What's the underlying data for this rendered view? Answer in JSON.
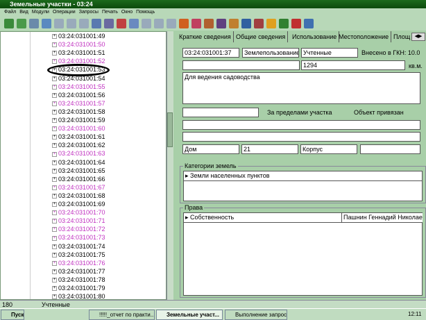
{
  "window": {
    "title": "Земельные участки - 03:24"
  },
  "menu": [
    "Файл",
    "Вид",
    "Модули",
    "Операции",
    "Запросы",
    "Печать",
    "Окно",
    "Помощь"
  ],
  "tree": {
    "items": [
      {
        "label": "03:24:031001:49",
        "color": "#000"
      },
      {
        "label": "03:24:031001:50",
        "color": "#c030c0"
      },
      {
        "label": "03:24:031001:51",
        "color": "#000"
      },
      {
        "label": "03:24:031001:52",
        "color": "#c030c0"
      },
      {
        "label": "03:24:031001:53",
        "color": "#000"
      },
      {
        "label": "03:24:031001:54",
        "color": "#000"
      },
      {
        "label": "03:24:031001:55",
        "color": "#c030c0"
      },
      {
        "label": "03:24:031001:56",
        "color": "#000"
      },
      {
        "label": "03:24:031001:57",
        "color": "#c030c0"
      },
      {
        "label": "03:24:031001:58",
        "color": "#000"
      },
      {
        "label": "03:24:031001:59",
        "color": "#000"
      },
      {
        "label": "03:24:031001:60",
        "color": "#c030c0"
      },
      {
        "label": "03:24:031001:61",
        "color": "#000"
      },
      {
        "label": "03:24:031001:62",
        "color": "#000"
      },
      {
        "label": "03:24:031001:63",
        "color": "#c030c0"
      },
      {
        "label": "03:24:031001:64",
        "color": "#000"
      },
      {
        "label": "03:24:031001:65",
        "color": "#000"
      },
      {
        "label": "03:24:031001:66",
        "color": "#000"
      },
      {
        "label": "03:24:031001:67",
        "color": "#c030c0"
      },
      {
        "label": "03:24:031001:68",
        "color": "#000"
      },
      {
        "label": "03:24:031001:69",
        "color": "#000"
      },
      {
        "label": "03:24:031001:70",
        "color": "#c030c0"
      },
      {
        "label": "03:24:031001:71",
        "color": "#c030c0"
      },
      {
        "label": "03:24:031001:72",
        "color": "#c030c0"
      },
      {
        "label": "03:24:031001:73",
        "color": "#c030c0"
      },
      {
        "label": "03:24:031001:74",
        "color": "#000"
      },
      {
        "label": "03:24:031001:75",
        "color": "#000"
      },
      {
        "label": "03:24:031001:76",
        "color": "#c030c0"
      },
      {
        "label": "03:24:031001:77",
        "color": "#000"
      },
      {
        "label": "03:24:031001:78",
        "color": "#000"
      },
      {
        "label": "03:24:031001:79",
        "color": "#000"
      },
      {
        "label": "03:24:031001:80",
        "color": "#000"
      }
    ]
  },
  "tabs": [
    "Краткие сведения",
    "Общие сведения",
    "Использование",
    "Местоположение",
    "Площ"
  ],
  "form": {
    "cadastral_number": "03:24:031001:37",
    "category_type": "Землепользование",
    "status": "Учтенные",
    "gkn_label": "Внесено в ГКН: 10.0",
    "area": "1294",
    "area_unit": "кв.м.",
    "purpose": "Для ведения садоводства",
    "outside_label": "За пределами участка",
    "bound_label": "Объект привязан",
    "house_label": "Дом",
    "house_value": "21",
    "building_label": "Корпус"
  },
  "land_categories": {
    "title": "Категории земель",
    "row": "Земли населенных пунктов"
  },
  "rights": {
    "title": "Права",
    "type": "Собственность",
    "owner": "Пашнин Геннадий Николае"
  },
  "status_bar": {
    "count": "180",
    "status": "Учтенные"
  },
  "taskbar": {
    "start": "Пуск",
    "tasks": [
      "!!!!!_отчет по практи...",
      "Земельные участ...",
      "Выполнение запроса"
    ],
    "clock": "12:11"
  }
}
